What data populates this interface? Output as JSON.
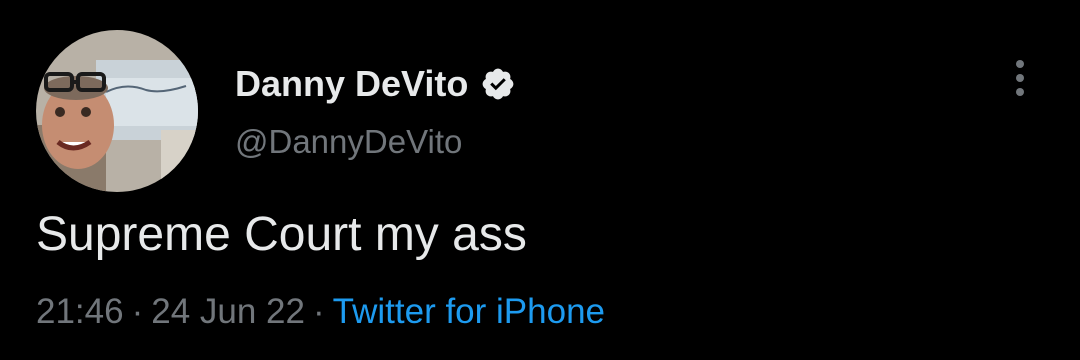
{
  "tweet": {
    "author": {
      "display_name": "Danny DeVito",
      "handle": "@DannyDeVito",
      "verified": true
    },
    "text": "Supreme Court my ass",
    "meta": {
      "time": "21:46",
      "separator": "·",
      "date": "24 Jun 22",
      "source": "Twitter for iPhone"
    },
    "icons": {
      "verified": "verified-badge-icon",
      "more": "more-vertical-icon"
    }
  },
  "colors": {
    "background": "#000000",
    "primary_text": "#e7e9ea",
    "secondary_text": "#71767b",
    "link": "#1d9bf0"
  }
}
